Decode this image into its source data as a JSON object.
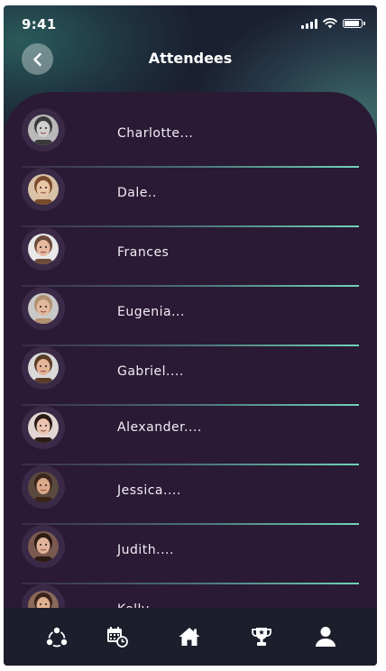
{
  "status_bar": {
    "time": "9:41"
  },
  "header": {
    "title": "Attendees",
    "back_icon": "chevron-left-icon"
  },
  "attendees": [
    {
      "name": "Charlotte...",
      "skin": "#cfcfcf",
      "hair": "#3a3a3a",
      "bg": "#b9b9b9"
    },
    {
      "name": "Dale..",
      "skin": "#e8c7a6",
      "hair": "#7a4b2a",
      "bg": "#d8c2a8"
    },
    {
      "name": "Frances",
      "skin": "#e6b9a0",
      "hair": "#6b4a3a",
      "bg": "#e8e8e8"
    },
    {
      "name": "Eugenia...",
      "skin": "#e0b89c",
      "hair": "#b09070",
      "bg": "#c9c9c9"
    },
    {
      "name": "Gabriel....",
      "skin": "#e3b596",
      "hair": "#5a3b28",
      "bg": "#d9d9d9"
    },
    {
      "name": "Alexander....",
      "skin": "#eac4b0",
      "hair": "#2a1b14",
      "bg": "#e2d6d2"
    },
    {
      "name": "Jessica....",
      "skin": "#d9a98a",
      "hair": "#3b2418",
      "bg": "#5a4a40"
    },
    {
      "name": "Judith....",
      "skin": "#e1b49a",
      "hair": "#2d1b14",
      "bg": "#7a5a50"
    },
    {
      "name": "Kelly...",
      "skin": "#e0b090",
      "hair": "#3a241a",
      "bg": "#8a6a5a"
    }
  ],
  "bottom_nav": [
    {
      "icon": "community-icon"
    },
    {
      "icon": "calendar-clock-icon"
    },
    {
      "icon": "home-icon"
    },
    {
      "icon": "trophy-icon"
    },
    {
      "icon": "profile-icon"
    }
  ],
  "colors": {
    "panel": "#2a1a35",
    "accent": "#6fd3b9",
    "nav_bg": "#1c1e2c"
  }
}
